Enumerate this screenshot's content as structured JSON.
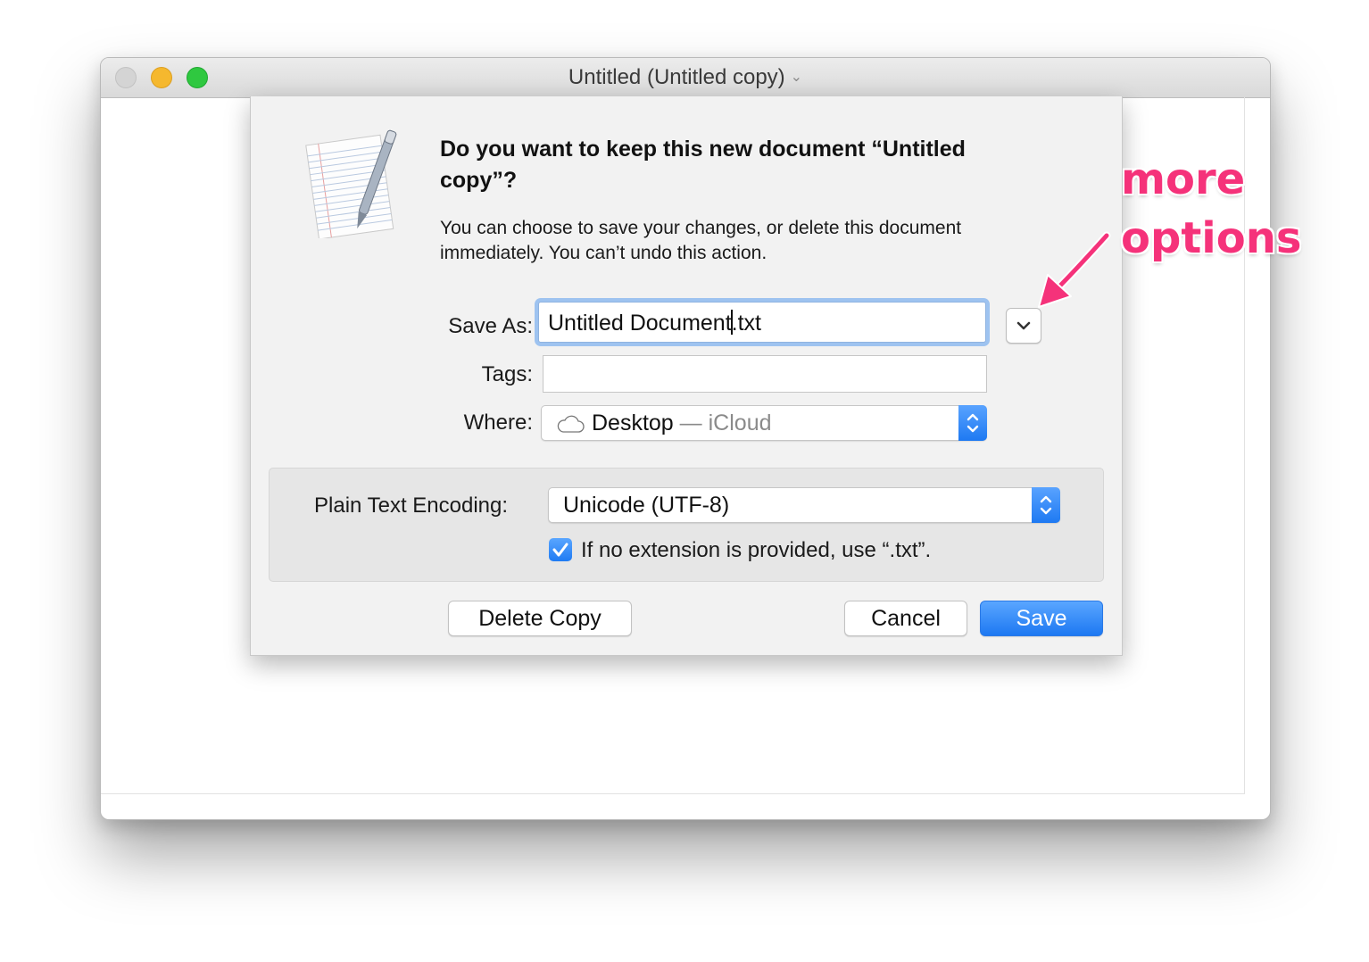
{
  "window": {
    "title": "Untitled (Untitled copy)",
    "title_menu_icon": "chevron-down-icon"
  },
  "dialog": {
    "icon": "textedit-document-icon",
    "heading": "Do you want to keep this new document “Untitled copy”?",
    "message": "You can choose to save your changes, or delete this document immediately. You can’t undo this action.",
    "save_as": {
      "label": "Save As:",
      "value_before_caret": "Untitled Document",
      "value_after_caret": ".txt"
    },
    "more_options_icon": "chevron-down-icon",
    "tags": {
      "label": "Tags:",
      "value": ""
    },
    "where": {
      "label": "Where:",
      "location": "Desktop",
      "separator": " — ",
      "service": "iCloud",
      "icon": "cloud-icon"
    },
    "options": {
      "encoding_label": "Plain Text Encoding:",
      "encoding_value": "Unicode (UTF-8)",
      "extension_checkbox_checked": true,
      "extension_checkbox_label": "If no extension is provided, use “.txt”."
    },
    "buttons": {
      "delete": "Delete Copy",
      "cancel": "Cancel",
      "save": "Save"
    }
  },
  "annotation": {
    "line1": "more",
    "line2": "options",
    "color": "#f5327a"
  },
  "colors": {
    "accent": "#1e79f2",
    "focus_ring": "#9ec3f0",
    "traffic_close": "#d4d4d4",
    "traffic_minimize": "#f5b82e",
    "traffic_zoom": "#2fc840"
  }
}
